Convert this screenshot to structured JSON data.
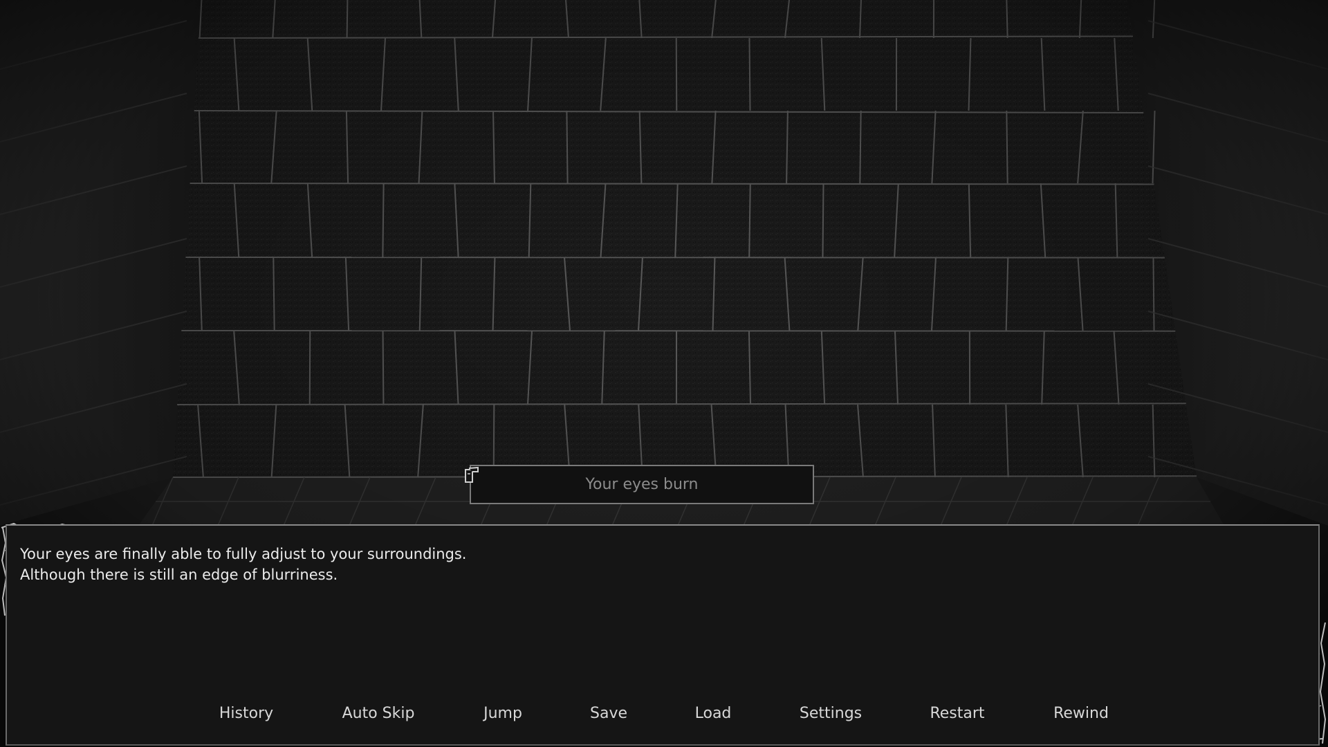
{
  "scene": {
    "background": "dungeon-stone-wall",
    "palette": {
      "wall_dark": "#1a1a1a",
      "wall_mid": "#2a2a2a",
      "mortar": "#6e6e6e",
      "textbox_bg": "#151515",
      "text": "#ececec",
      "nametag_text": "#8c8c8c"
    }
  },
  "nametag": {
    "text": "Your eyes burn",
    "icon": "scroll-icon"
  },
  "dialogue": {
    "lines": [
      "Your eyes are finally able to fully adjust to your surroundings.",
      "Although there is still an edge of blurriness."
    ]
  },
  "quick_menu": {
    "history": "History",
    "auto_skip": "Auto Skip",
    "jump": "Jump",
    "save": "Save",
    "load": "Load",
    "settings": "Settings",
    "restart": "Restart",
    "rewind": "Rewind"
  }
}
